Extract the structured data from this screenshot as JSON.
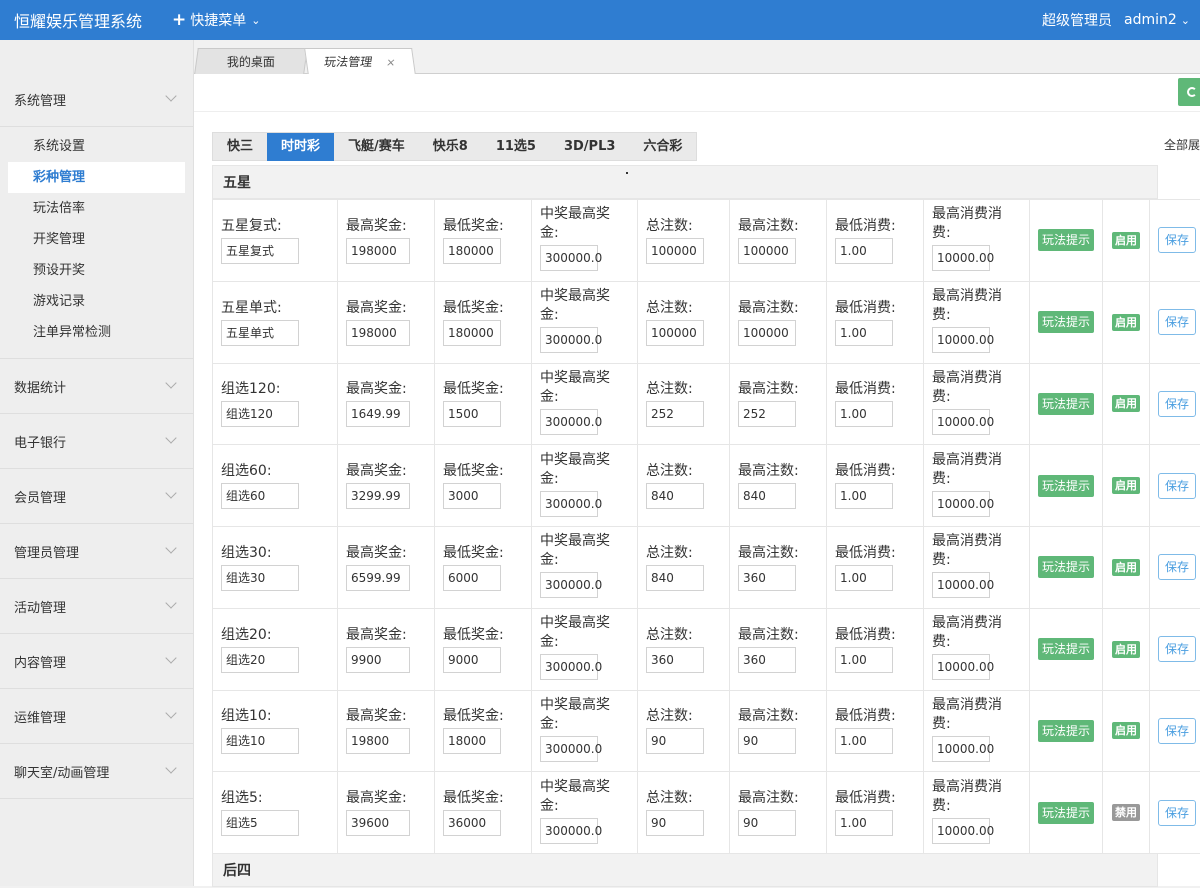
{
  "header": {
    "brand": "恒耀娱乐管理系统",
    "quick_menu": "快捷菜单",
    "role": "超级管理员",
    "username": "admin2"
  },
  "sidebar": {
    "groups": [
      {
        "label": "系统管理",
        "children": [
          "系统设置",
          "彩种管理",
          "玩法倍率",
          "开奖管理",
          "预设开奖",
          "游戏记录",
          "注单异常检测"
        ],
        "active_child": "彩种管理"
      },
      {
        "label": "数据统计"
      },
      {
        "label": "电子银行"
      },
      {
        "label": "会员管理"
      },
      {
        "label": "管理员管理"
      },
      {
        "label": "活动管理"
      },
      {
        "label": "内容管理"
      },
      {
        "label": "运维管理"
      },
      {
        "label": "聊天室/动画管理"
      }
    ]
  },
  "window_tabs": [
    {
      "label": "我的桌面"
    },
    {
      "label": "玩法管理",
      "close": "×"
    }
  ],
  "lottery_tabs": [
    "快三",
    "时时彩",
    "飞艇/赛车",
    "快乐8",
    "11选5",
    "3D/PL3",
    "六合彩"
  ],
  "active_lottery_tab": "时时彩",
  "expand_all": "全部展",
  "labels": {
    "max_prize": "最高奖金:",
    "min_prize": "最低奖金:",
    "max_win": "中奖最高奖金:",
    "total_bets": "总注数:",
    "max_bets": "最高注数:",
    "min_spend": "最低消费:",
    "max_spend": "最高消费消费:",
    "tip_button": "玩法提示",
    "save_button": "保存"
  },
  "sections": [
    {
      "title": "五星"
    },
    {
      "title": "后四"
    }
  ],
  "rows": [
    {
      "name_label": "五星复式:",
      "name": "五星复式",
      "max_prize": "198000",
      "min_prize": "180000",
      "max_win": "300000.0",
      "total_bets": "100000",
      "max_bets": "100000",
      "min_spend": "1.00",
      "max_spend": "10000.00",
      "status": "启用"
    },
    {
      "name_label": "五星单式:",
      "name": "五星单式",
      "max_prize": "198000",
      "min_prize": "180000",
      "max_win": "300000.0",
      "total_bets": "100000",
      "max_bets": "100000",
      "min_spend": "1.00",
      "max_spend": "10000.00",
      "status": "启用"
    },
    {
      "name_label": "组选120:",
      "name": "组选120",
      "max_prize": "1649.99",
      "min_prize": "1500",
      "max_win": "300000.0",
      "total_bets": "252",
      "max_bets": "252",
      "min_spend": "1.00",
      "max_spend": "10000.00",
      "status": "启用"
    },
    {
      "name_label": "组选60:",
      "name": "组选60",
      "max_prize": "3299.99",
      "min_prize": "3000",
      "max_win": "300000.0",
      "total_bets": "840",
      "max_bets": "840",
      "min_spend": "1.00",
      "max_spend": "10000.00",
      "status": "启用"
    },
    {
      "name_label": "组选30:",
      "name": "组选30",
      "max_prize": "6599.99",
      "min_prize": "6000",
      "max_win": "300000.0",
      "total_bets": "840",
      "max_bets": "360",
      "min_spend": "1.00",
      "max_spend": "10000.00",
      "status": "启用"
    },
    {
      "name_label": "组选20:",
      "name": "组选20",
      "max_prize": "9900",
      "min_prize": "9000",
      "max_win": "300000.0",
      "total_bets": "360",
      "max_bets": "360",
      "min_spend": "1.00",
      "max_spend": "10000.00",
      "status": "启用"
    },
    {
      "name_label": "组选10:",
      "name": "组选10",
      "max_prize": "19800",
      "min_prize": "18000",
      "max_win": "300000.0",
      "total_bets": "90",
      "max_bets": "90",
      "min_spend": "1.00",
      "max_spend": "10000.00",
      "status": "启用"
    },
    {
      "name_label": "组选5:",
      "name": "组选5",
      "max_prize": "39600",
      "min_prize": "36000",
      "max_win": "300000.0",
      "total_bets": "90",
      "max_bets": "90",
      "min_spend": "1.00",
      "max_spend": "10000.00",
      "status": "禁用"
    }
  ]
}
